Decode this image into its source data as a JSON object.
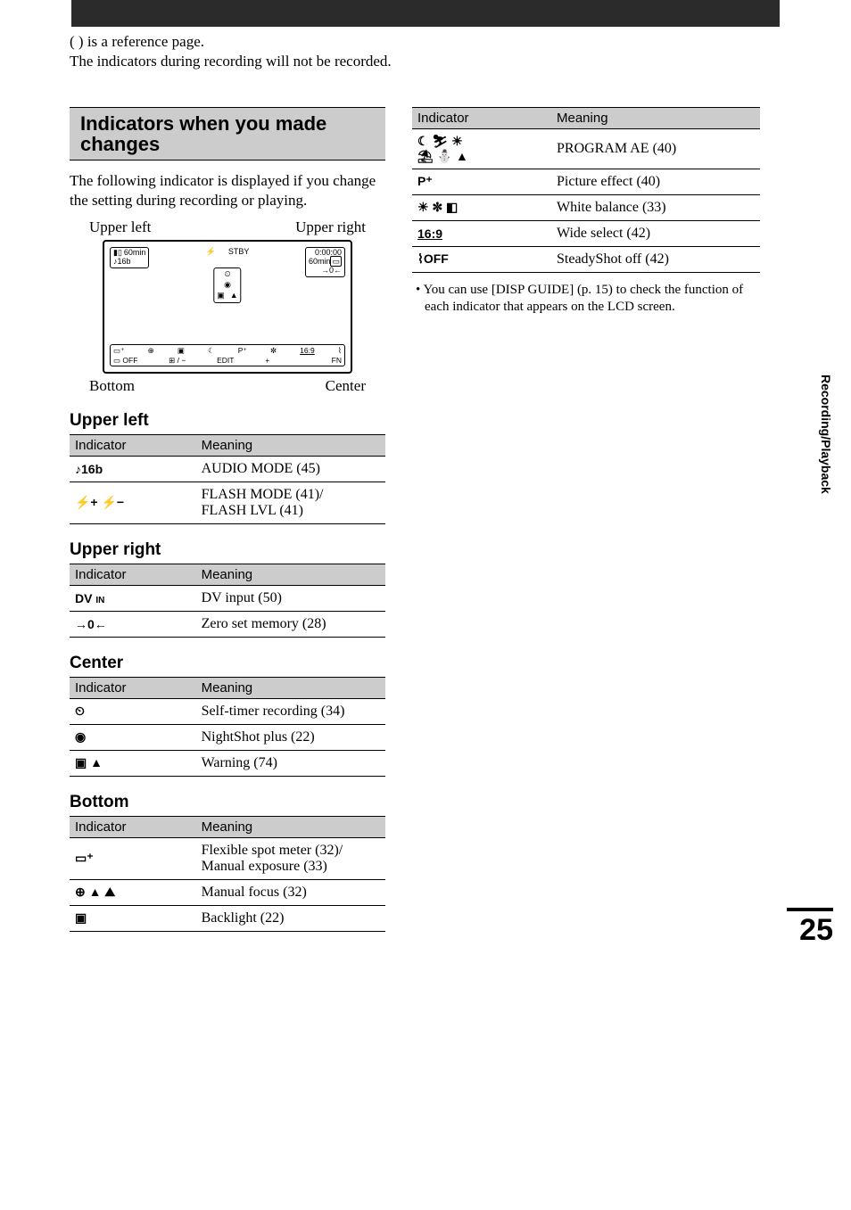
{
  "intro": {
    "line1": "( ) is a reference page.",
    "line2": "The indicators during recording will not be recorded."
  },
  "banner": "Indicators when you made changes",
  "explain": "The following indicator is displayed if you change the setting during recording or playing.",
  "diagram_labels": {
    "upper_left": "Upper left",
    "upper_right": "Upper right",
    "bottom": "Bottom",
    "center": "Center"
  },
  "viewfinder": {
    "tl_line1_batt": "60min",
    "tl_line2": "♪16b",
    "top_center_1": "⚡   ",
    "top_center_2": "STBY",
    "tr_line1": "0:00:00",
    "tr_line2": "60min",
    "tr_line3": "→0←",
    "center_row": [
      "⏲",
      "◉",
      "▣",
      "▲"
    ],
    "bottom_r1": [
      "▭⁺",
      "⊕",
      "▣",
      "☾",
      "P⁺",
      "✼",
      "16:9",
      "⌇"
    ],
    "bottom_r2": [
      "▭ OFF",
      "⊞ / −",
      "EDIT",
      "+",
      "",
      "FN"
    ]
  },
  "headers": {
    "indicator": "Indicator",
    "meaning": "Meaning"
  },
  "sections": {
    "upper_left": {
      "title": "Upper left",
      "rows": [
        {
          "ind": "♪16b",
          "meaning": "AUDIO MODE (45)"
        },
        {
          "ind": "⚡+  ⚡−",
          "meaning": "FLASH MODE (41)/\nFLASH LVL (41)"
        }
      ]
    },
    "upper_right": {
      "title": "Upper right",
      "rows": [
        {
          "ind": "DV IN",
          "meaning": "DV input (50)"
        },
        {
          "ind": "→0←",
          "meaning": "Zero set memory (28)"
        }
      ]
    },
    "center": {
      "title": "Center",
      "rows": [
        {
          "ind": "⏲",
          "meaning": "Self-timer recording (34)"
        },
        {
          "ind": "◉",
          "meaning": "NightShot plus (22)"
        },
        {
          "ind": "▣ ▲",
          "meaning": "Warning (74)"
        }
      ]
    },
    "bottom_left": {
      "title": "Bottom",
      "rows": [
        {
          "ind": "▭⁺",
          "meaning": "Flexible spot meter (32)/\nManual exposure (33)"
        },
        {
          "ind": "⊕ ▲ ⛰",
          "meaning": "Manual focus (32)"
        },
        {
          "ind": "▣",
          "meaning": "Backlight (22)"
        }
      ]
    },
    "bottom_right": {
      "rows": [
        {
          "ind": "☾ ⛷ ☀\n⛱ ⛄ ▲",
          "meaning": "PROGRAM AE (40)"
        },
        {
          "ind": "P⁺",
          "meaning": "Picture effect (40)"
        },
        {
          "ind": "☀ ✼ ◧",
          "meaning": "White balance (33)"
        },
        {
          "ind": "16:9",
          "meaning": "Wide select (42)"
        },
        {
          "ind": "⌇OFF",
          "meaning": "SteadyShot off (42)"
        }
      ]
    }
  },
  "note": "• You can use [DISP GUIDE] (p. 15) to check the function of each indicator that appears on the LCD screen.",
  "side_tab": "Recording/Playback",
  "page_num": "25"
}
